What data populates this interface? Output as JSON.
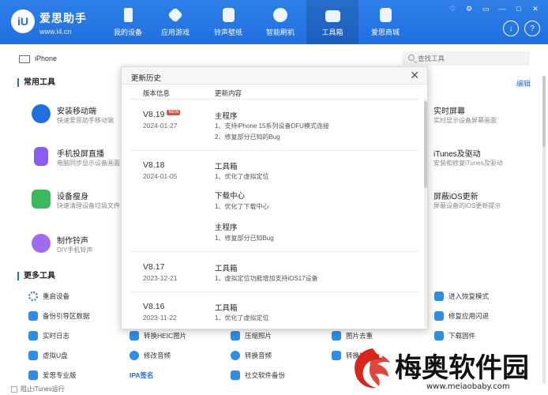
{
  "app": {
    "logo_glyph": "iU",
    "name": "爱思助手",
    "url": "www.i4.cn"
  },
  "nav": [
    {
      "label": "我的设备",
      "icon": "phone-icon"
    },
    {
      "label": "应用游戏",
      "icon": "cube-icon"
    },
    {
      "label": "铃声壁纸",
      "icon": "music-file-icon"
    },
    {
      "label": "智能刷机",
      "icon": "flash-icon"
    },
    {
      "label": "工具箱",
      "icon": "toolbox-icon",
      "active": true
    },
    {
      "label": "爱思商城",
      "icon": "shopping-bag-icon"
    }
  ],
  "window_controls": [
    "♡",
    "⚙",
    "▭",
    "—",
    "□",
    "✕"
  ],
  "round_buttons": [
    "↓",
    "?"
  ],
  "device": {
    "name": "iPhone"
  },
  "search": {
    "placeholder": "查找工具"
  },
  "common_tools": {
    "title": "常用工具",
    "edit_label": "编辑",
    "left": [
      {
        "title": "安装移动端",
        "desc": "快速爱思助手移动端",
        "color": "#1f6fe0"
      },
      {
        "title": "手机投屏直播",
        "desc": "电脑同步显示设备画面",
        "color": "#8a5cf0"
      },
      {
        "title": "设备瘦身",
        "desc": "快速清理设备垃圾文件",
        "color": "#3cb95c"
      },
      {
        "title": "制作铃声",
        "desc": "DIY手机铃声",
        "color": "#a06bf0"
      }
    ],
    "right": [
      {
        "title": "实时屏幕",
        "desc": "实时显示设备屏幕画面"
      },
      {
        "title": "iTunes及驱动",
        "desc": "安装和修复iTunes及驱动"
      },
      {
        "title": "屏蔽iOS更新",
        "desc": "屏蔽设备的iOS更新提示"
      }
    ]
  },
  "more_tools": {
    "title": "更多工具",
    "rows": [
      [
        {
          "label": "重启设备"
        },
        {
          "label": "进入恢复模式"
        }
      ],
      [
        {
          "label": "备份引导区数据"
        },
        {
          "label": "修复应用闪退"
        }
      ],
      [
        {
          "label": "实时日志"
        },
        {
          "label": "转换HEIC图片"
        },
        {
          "label": "压缩照片"
        },
        {
          "label": "图片去重"
        },
        {
          "label": "下载固件"
        }
      ],
      [
        {
          "label": "虚拟U盘"
        },
        {
          "label": "修改音频"
        },
        {
          "label": "转换音频"
        },
        {
          "label": "转换视频"
        }
      ],
      [
        {
          "label": "爱思专业版"
        },
        {
          "label": "IPA签名"
        },
        {
          "label": "社交软件备份"
        }
      ]
    ]
  },
  "footer": {
    "label": "阻止iTunes运行"
  },
  "modal": {
    "title": "更新历史",
    "close": "✕",
    "col_version": "版本信息",
    "col_content": "更新内容",
    "entries": [
      {
        "version": "V8.19",
        "badge": "NEW",
        "date": "2024-01-27",
        "groups": [
          {
            "title": "主程序",
            "items": [
              "1、支持iPhone 15系列设备DFU模式连接",
              "2、修复部分已知的Bug"
            ]
          }
        ]
      },
      {
        "version": "V8.18",
        "date": "2024-01-05",
        "groups": [
          {
            "title": "工具箱",
            "items": [
              "1、优化了虚拟定位"
            ]
          },
          {
            "title": "下载中心",
            "items": [
              "1、优化了下载中心"
            ]
          },
          {
            "title": "主程序",
            "items": [
              "1、修复部分已知Bug"
            ]
          }
        ]
      },
      {
        "version": "V8.17",
        "date": "2023-12-21",
        "groups": [
          {
            "title": "工具箱",
            "items": [
              "1、虚拟定位功能增加支持iOS17设备"
            ]
          }
        ]
      },
      {
        "version": "V8.16",
        "date": "2023-11-22",
        "groups": [
          {
            "title": "工具箱",
            "items": [
              "1、优化了虚拟定位"
            ]
          }
        ]
      }
    ]
  },
  "watermark": {
    "name": "梅奥软件园",
    "url": "www.meiaobaby.com",
    "accent": "#d8261c"
  }
}
